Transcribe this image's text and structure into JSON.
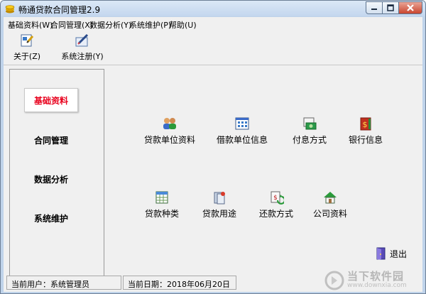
{
  "window": {
    "title": "畅通贷款合同管理2.9",
    "title_icon": "coin-stack-icon"
  },
  "menubar": {
    "items": [
      "基础资料(W)",
      "合同管理(X)",
      "数据分析(Y)",
      "系统维护(P)",
      "帮助(U)"
    ]
  },
  "toolbar": {
    "about_label": "关于(Z)",
    "register_label": "系统注册(Y)"
  },
  "nav": {
    "items": [
      "基础资料",
      "合同管理",
      "数据分析",
      "系统维护"
    ],
    "selected": "基础资料",
    "selected_color": "#e8001c"
  },
  "functions": {
    "row1": [
      {
        "label": "贷款单位资料",
        "icon": "people-icon"
      },
      {
        "label": "借款单位信息",
        "icon": "grid-window-icon"
      },
      {
        "label": "付息方式",
        "icon": "money-card-icon"
      },
      {
        "label": "银行信息",
        "icon": "dollar-book-icon"
      }
    ],
    "row2": [
      {
        "label": "贷款种类",
        "icon": "table-icon"
      },
      {
        "label": "贷款用途",
        "icon": "document-stack-icon"
      },
      {
        "label": "还款方式",
        "icon": "refresh-money-icon"
      },
      {
        "label": "公司资料",
        "icon": "house-icon"
      }
    ]
  },
  "exit": {
    "label": "退出",
    "icon": "door-exit-icon"
  },
  "status": {
    "user": "当前用户：系统管理员",
    "date": "当前日期：2018年06月20日"
  },
  "watermark": {
    "cn": "当下软件园",
    "en": "www.downxia.com"
  }
}
